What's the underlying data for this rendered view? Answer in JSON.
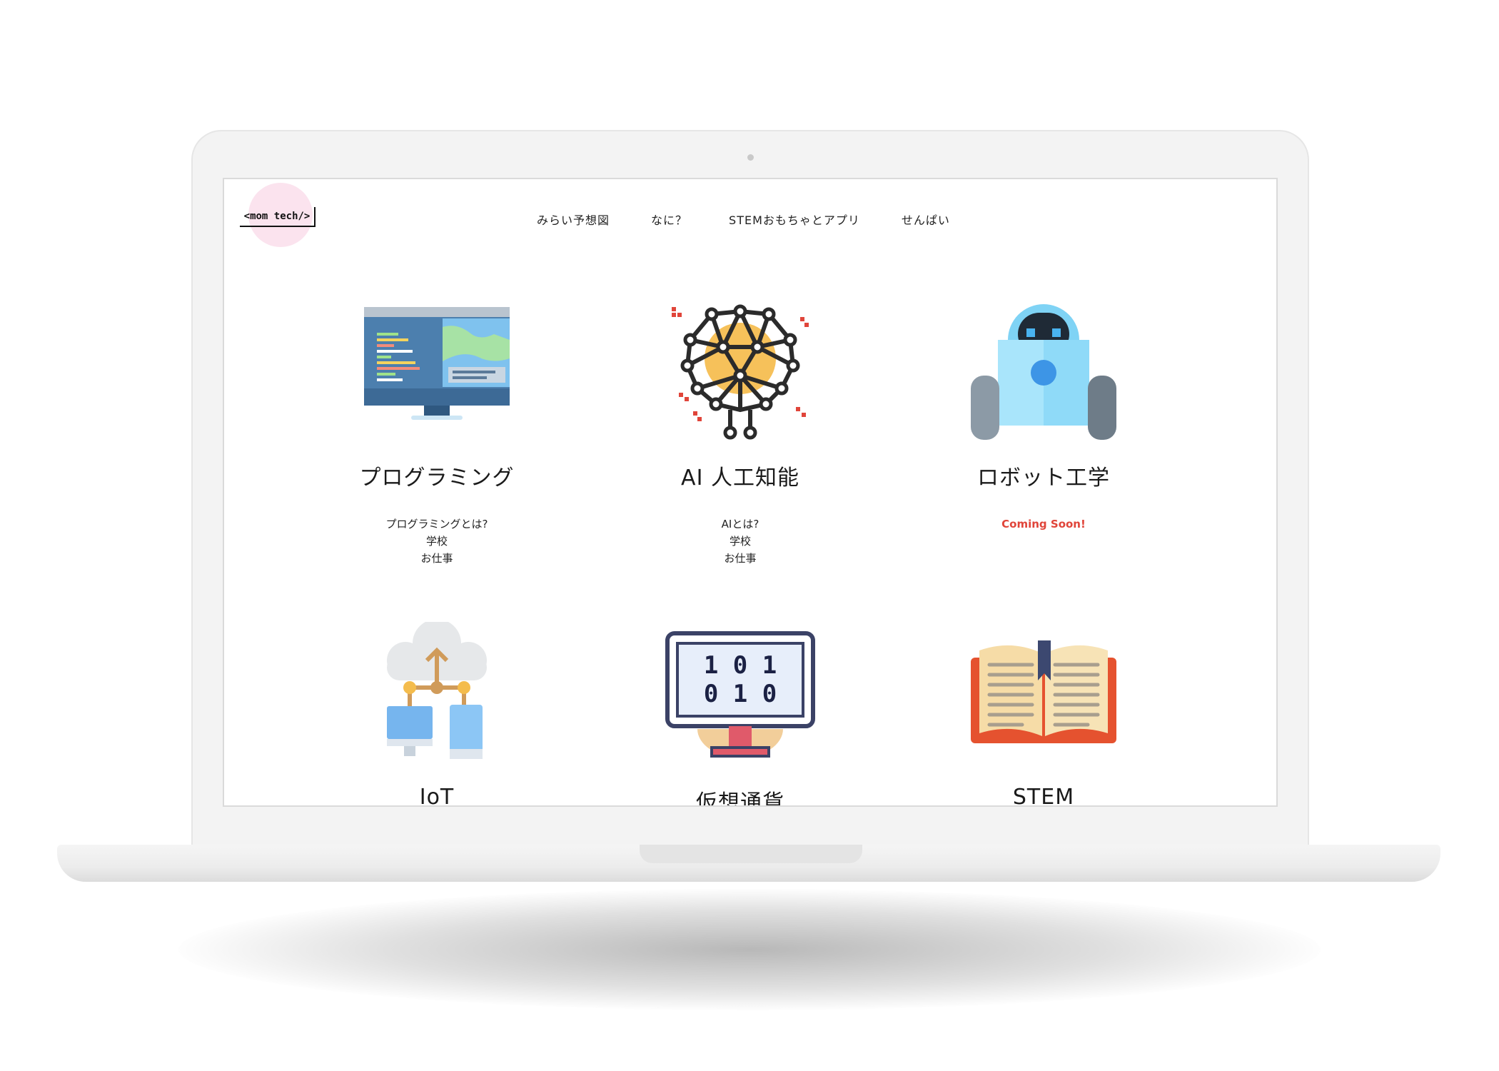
{
  "logo": {
    "text": "<mom tech/>"
  },
  "nav": [
    {
      "label": "みらい予想図"
    },
    {
      "label": "なに？"
    },
    {
      "label": "STEMおもちゃとアプリ"
    },
    {
      "label": "せんぱい"
    }
  ],
  "cards": [
    {
      "title": "プログラミング",
      "icon": "computer-code-icon",
      "links": [
        "プログラミングとは?",
        "学校",
        "お仕事"
      ]
    },
    {
      "title": "AI 人工知能",
      "icon": "ai-brain-network-icon",
      "links": [
        "AIとは?",
        "学校",
        "お仕事"
      ]
    },
    {
      "title": "ロボット工学",
      "icon": "robot-icon",
      "status": "Coming Soon!",
      "status_color": "#e0453a"
    },
    {
      "title": "IoT",
      "icon": "cloud-network-icon"
    },
    {
      "title": "仮想通貨",
      "icon": "binary-monitor-icon",
      "binary": [
        "1 0 1",
        "0 1 0"
      ]
    },
    {
      "title": "STEM",
      "icon": "open-book-icon"
    }
  ]
}
